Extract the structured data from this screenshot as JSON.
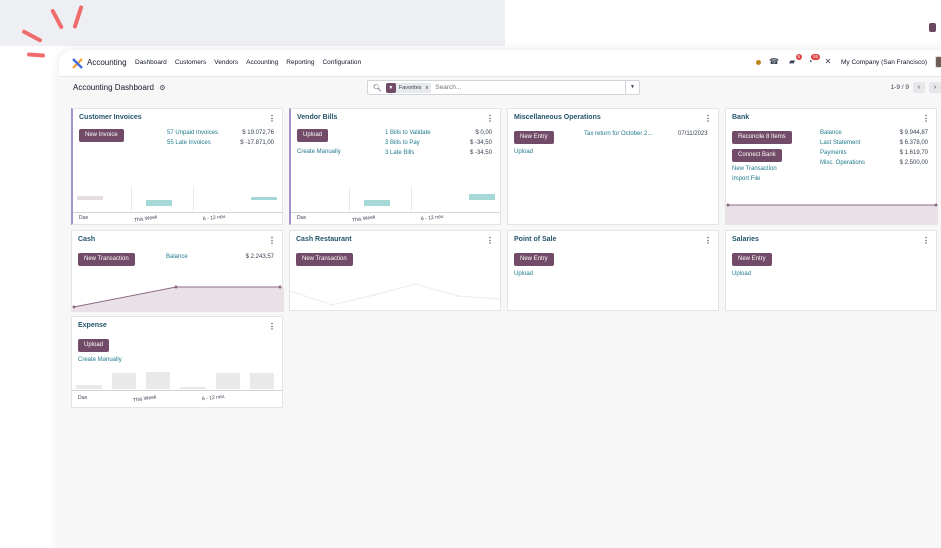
{
  "navbar": {
    "app_name": "Accounting",
    "menu": [
      "Dashboard",
      "Customers",
      "Vendors",
      "Accounting",
      "Reporting",
      "Configuration"
    ],
    "chat_badge": "5",
    "activity_badge": "26",
    "company": "My Company (San Francisco)"
  },
  "control": {
    "breadcrumb": "Accounting Dashboard",
    "facet": "Favorites",
    "search_placeholder": "Search...",
    "pager": "1-9 / 9"
  },
  "colors": {
    "primary": "#714b67",
    "link": "#1f7a8c",
    "title": "#24546a",
    "bar_teal": "#a7d8d8",
    "bar_gray": "#e3dde1"
  },
  "cards": {
    "customer_invoices": {
      "title": "Customer Invoices",
      "button": "New Invoice",
      "rows": [
        {
          "label": "57 Unpaid Invoices",
          "value": "$ 19.072,76"
        },
        {
          "label": "55 Late Invoices",
          "value": "$ -17.871,00"
        }
      ],
      "axis": [
        "Due",
        "This Week",
        "6 - 12 nov."
      ]
    },
    "vendor_bills": {
      "title": "Vendor Bills",
      "button": "Upload",
      "link": "Create Manually",
      "rows": [
        {
          "label": "1 Bills to Validate",
          "value": "$ 0,00"
        },
        {
          "label": "3 Bills to Pay",
          "value": "$ -34,50"
        },
        {
          "label": "3 Late Bills",
          "value": "$ -34,50"
        }
      ],
      "axis": [
        "Due",
        "This Week",
        "6 - 12 nov."
      ]
    },
    "misc": {
      "title": "Miscellaneous Operations",
      "button": "New Entry",
      "link": "Upload",
      "item": "Tax return for October 2...",
      "date": "07/11/2023"
    },
    "bank": {
      "title": "Bank",
      "button1": "Reconcile 8 Items",
      "button2": "Connect Bank",
      "link1": "New Transaction",
      "link2": "Import File",
      "rows": [
        {
          "label": "Balance",
          "value": "$ 9.944,87"
        },
        {
          "label": "Last Statement",
          "value": "$ 6.378,00"
        },
        {
          "label": "Payments",
          "value": "$ 1.619,70"
        },
        {
          "label": "Misc. Operations",
          "value": "$ 2.500,00"
        }
      ]
    },
    "cash": {
      "title": "Cash",
      "button": "New Transaction",
      "balance_label": "Balance",
      "balance_value": "$ 2.243,57"
    },
    "cash_restaurant": {
      "title": "Cash Restaurant",
      "button": "New Transaction"
    },
    "pos": {
      "title": "Point of Sale",
      "button": "New Entry",
      "link": "Upload"
    },
    "salaries": {
      "title": "Salaries",
      "button": "New Entry",
      "link": "Upload"
    },
    "expense": {
      "title": "Expense",
      "button": "Upload",
      "link": "Create Manually",
      "axis": [
        "Due",
        "This Week",
        "6 - 12 nov."
      ]
    }
  }
}
